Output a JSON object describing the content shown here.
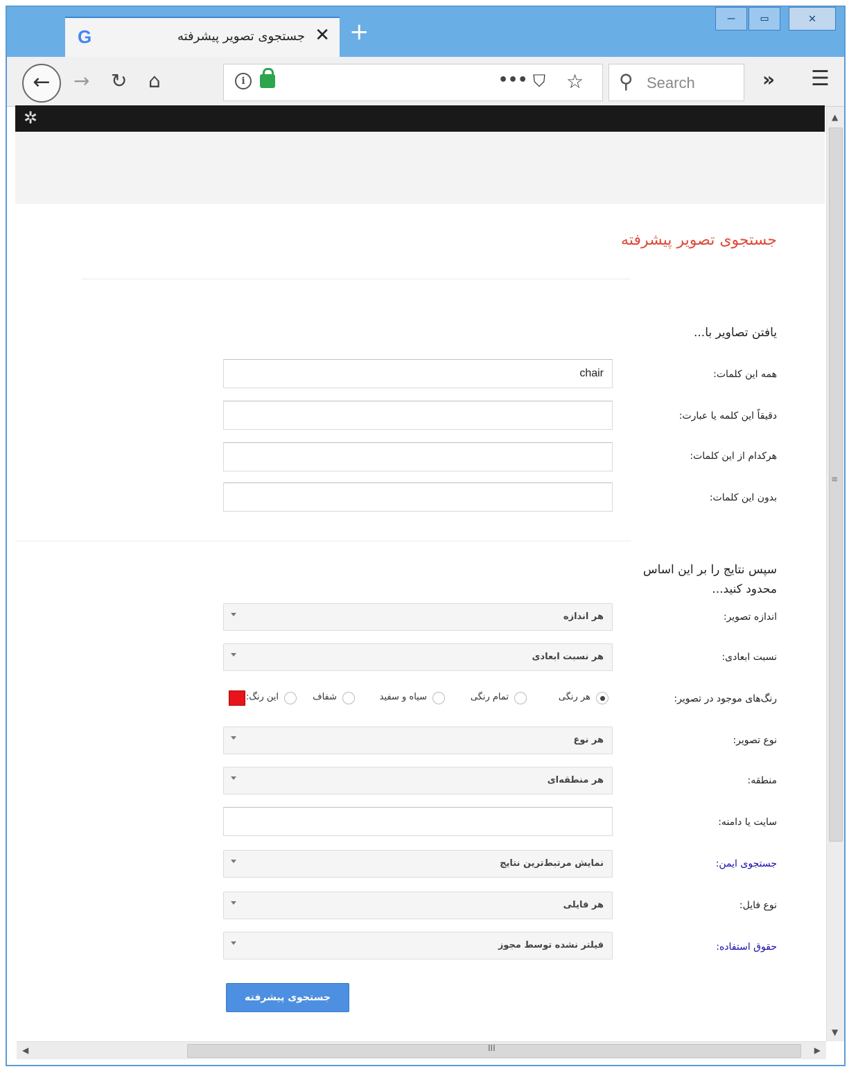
{
  "browser": {
    "tab_title": "جستجوی تصویر پیشرفته",
    "tab_favicon": "G",
    "tab_close": "✕",
    "new_tab": "+",
    "window_controls": [
      "–",
      "▭",
      "✕"
    ],
    "nav": {
      "back": "←",
      "forward": "→",
      "reload": "↻",
      "home": "⌂"
    },
    "url_icons": {
      "info": "i",
      "more": "•••",
      "pocket": "⛉",
      "star": "☆"
    },
    "search_placeholder": "Search",
    "overflow": "»",
    "menu": "☰"
  },
  "settings_icon": "✲",
  "page": {
    "title": "جستجوی تصویر پیشرفته",
    "find_section": "یافتن تصاویر با...",
    "fields": [
      {
        "label": "همه این کلمات:",
        "value": "chair"
      },
      {
        "label": "دقیقاً این کلمه یا عبارت:",
        "value": ""
      },
      {
        "label": "هرکدام از این کلمات:",
        "value": ""
      },
      {
        "label": "بدون این کلمات:",
        "value": ""
      }
    ],
    "narrow_section": [
      "سپس نتایج را بر این اساس",
      "محدود کنید..."
    ],
    "filters": {
      "image_size": {
        "label": "اندازه تصویر:",
        "value": "هر اندازه"
      },
      "aspect_ratio": {
        "label": "نسبت ابعادی:",
        "value": "هر نسبت ابعادی"
      },
      "colors": {
        "label": "رنگ‌های موجود در تصویر:",
        "options": [
          "هر رنگی",
          "تمام رنگی",
          "سیاه و سفید",
          "شفاف",
          "این رنگ:"
        ],
        "selected": "هر رنگی",
        "swatch_color": "#e8141b"
      },
      "image_type": {
        "label": "نوع تصویر:",
        "value": "هر نوع"
      },
      "region": {
        "label": "منطقه:",
        "value": "هر منطقه‌ای"
      },
      "site": {
        "label": "سایت یا دامنه:",
        "value": ""
      },
      "safe_search": {
        "label": "جستجوی ایمن:",
        "value": "نمایش مرتبط‌ترین نتایج"
      },
      "file_type": {
        "label": "نوع فایل:",
        "value": "هر فایلی"
      },
      "usage_rights": {
        "label": "حقوق استفاده:",
        "value": "فیلتر نشده توسط مجوز"
      }
    },
    "submit": "جستجوی پیشرفته"
  },
  "scrollbar_grip": "III",
  "colors": {
    "accent_title": "#dd4b39",
    "submit_bg": "#4d8fe0",
    "link": "#1a0dab"
  }
}
